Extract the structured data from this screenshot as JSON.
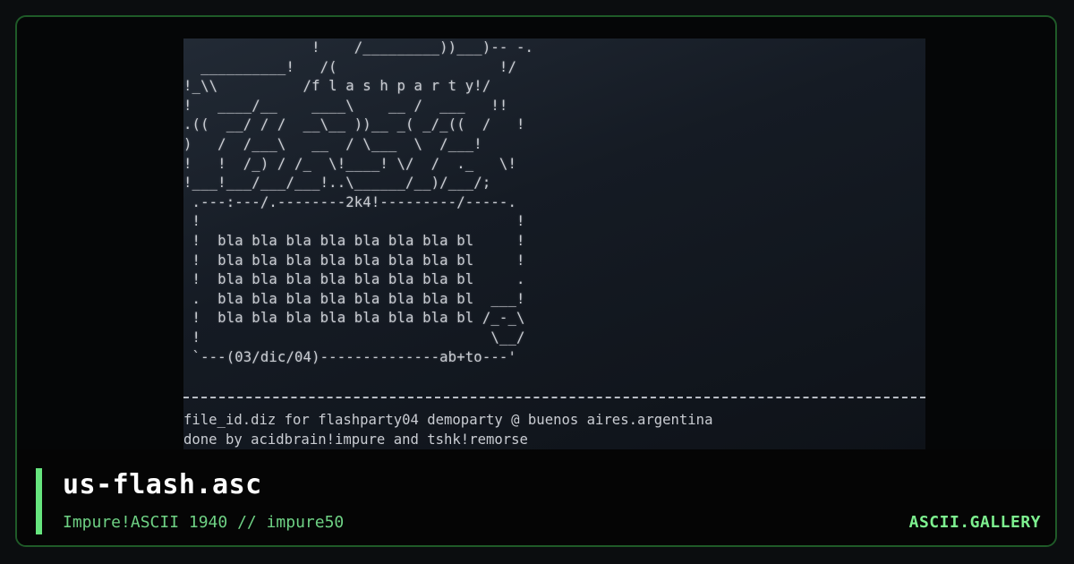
{
  "art": {
    "ascii_lines": [
      "               !    /_________))___)-- -.",
      "  __________!   /(                   !/",
      "!_\\\\          /f l a s h p a r t y!/",
      "!   ____/__    ____\\    __ /  ___   !!",
      ".((  __/ / /  __\\__ ))__ _( _/_((  /   !",
      ")   /  /___\\   __  / \\___  \\  /___!",
      "!   !  /_) / /_  \\!____! \\/  /  ._   \\!",
      "!___!___/___/___!..\\______/__)/___/;",
      " .---:---/.--------2k4!---------/-----.",
      " !                                     !",
      " !  bla bla bla bla bla bla bla bl     !",
      " !  bla bla bla bla bla bla bla bl     !",
      " !  bla bla bla bla bla bla bla bl     .",
      " .  bla bla bla bla bla bla bla bl  ___!",
      " !  bla bla bla bla bla bla bla bl /_-_\\",
      " !                                  \\__/",
      " `---(03/dic/04)--------------ab+to---'"
    ],
    "info_lines": [
      "file_id.diz for flashparty04 demoparty @ buenos aires.argentina",
      "done by acidbrain!impure and tshk!remorse"
    ]
  },
  "footer": {
    "title": "us-flash.asc",
    "subtitle": "Impure!ASCII 1940 // impure50",
    "brand": "ASCII.GALLERY"
  },
  "colors": {
    "accent": "#66e57e",
    "border": "#1f5a28",
    "background": "#050607"
  }
}
